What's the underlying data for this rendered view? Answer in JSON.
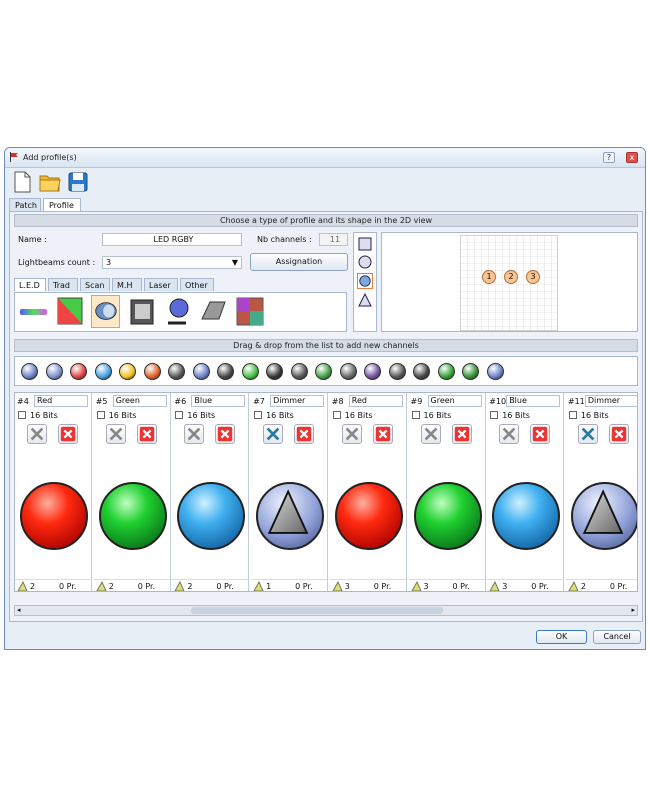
{
  "window": {
    "title": "Add profile(s)",
    "help_btn": "?",
    "close_btn": "x",
    "min_btn": "_",
    "max_btn": "□"
  },
  "toolbar": {
    "new_icon": "new-document-icon",
    "open_icon": "folder-open-icon",
    "save_icon": "save-disk-icon"
  },
  "tabs": [
    {
      "label": "Patch"
    },
    {
      "label": "Profile"
    }
  ],
  "profile_section": {
    "header": "Choose a type of profile and its shape in the 2D view",
    "name_label": "Name :",
    "name_value": "LED RGBY",
    "nb_channels_label": "Nb channels :",
    "nb_channels_value": "11",
    "lightbeams_label": "Lightbeams count :",
    "lightbeams_value": "3",
    "assignation_button": "Assignation"
  },
  "fixture_tabs": [
    {
      "label": "L.E.D"
    },
    {
      "label": "Trad"
    },
    {
      "label": "Scan"
    },
    {
      "label": "M.H"
    },
    {
      "label": "Laser"
    },
    {
      "label": "Other"
    }
  ],
  "shapes": [
    "square",
    "circle",
    "circle-filled",
    "triangle"
  ],
  "view2d": {
    "beams": [
      "1",
      "2",
      "3"
    ]
  },
  "channels_header": "Drag & drop from the list to add new channels",
  "channel_types": [
    {
      "icon": "intensity-triangle",
      "color": "#6a7fc8"
    },
    {
      "icon": "intensity-triangle",
      "color": "#7a8ed0"
    },
    {
      "icon": "color-wheel",
      "color": "#e04040"
    },
    {
      "icon": "color-wheel",
      "color": "#40a0e0"
    },
    {
      "icon": "yellow-circle",
      "color": "#f0c020"
    },
    {
      "icon": "rgb-triangle",
      "color": "#e06020"
    },
    {
      "icon": "dark-circle",
      "color": "#555555"
    },
    {
      "icon": "lock-circle",
      "color": "#6a7fc8"
    },
    {
      "icon": "gobo-circle",
      "color": "#444444"
    },
    {
      "icon": "green-circle",
      "color": "#40c040"
    },
    {
      "icon": "gobo-circle",
      "color": "#333333"
    },
    {
      "icon": "gobo-circle",
      "color": "#555555"
    },
    {
      "icon": "gobo-green",
      "color": "#40a040"
    },
    {
      "icon": "gobo-circle",
      "color": "#666666"
    },
    {
      "icon": "prism-circle",
      "color": "#7050a0"
    },
    {
      "icon": "gobo-circle",
      "color": "#555555"
    },
    {
      "icon": "gobo-circle",
      "color": "#444444"
    },
    {
      "icon": "green-circle",
      "color": "#30a030"
    },
    {
      "icon": "green-square",
      "color": "#309030"
    },
    {
      "icon": "help-circle",
      "color": "#6a7fc8"
    }
  ],
  "channels": [
    {
      "no": "#4",
      "name": "Red",
      "bits": "16 Bits",
      "orb": "red",
      "count": "2",
      "pr": "0 Pr."
    },
    {
      "no": "#5",
      "name": "Green",
      "bits": "16 Bits",
      "orb": "green",
      "count": "2",
      "pr": "0 Pr."
    },
    {
      "no": "#6",
      "name": "Blue",
      "bits": "16 Bits",
      "orb": "blue",
      "count": "2",
      "pr": "0 Pr."
    },
    {
      "no": "#7",
      "name": "Dimmer",
      "bits": "16 Bits",
      "orb": "dimmer",
      "count": "1",
      "pr": "0 Pr."
    },
    {
      "no": "#8",
      "name": "Red",
      "bits": "16 Bits",
      "orb": "red",
      "count": "3",
      "pr": "0 Pr."
    },
    {
      "no": "#9",
      "name": "Green",
      "bits": "16 Bits",
      "orb": "green",
      "count": "3",
      "pr": "0 Pr."
    },
    {
      "no": "#10",
      "name": "Blue",
      "bits": "16 Bits",
      "orb": "blue",
      "count": "3",
      "pr": "0 Pr."
    },
    {
      "no": "#11",
      "name": "Dimmer",
      "bits": "16 Bits",
      "orb": "dimmer",
      "count": "2",
      "pr": "0 Pr."
    }
  ],
  "buttons": {
    "ok": "OK",
    "cancel": "Cancel"
  },
  "colors": {
    "red": "#e52222",
    "green": "#18b02a",
    "blue": "#2a9ad6",
    "accent": "#6d8db8"
  }
}
